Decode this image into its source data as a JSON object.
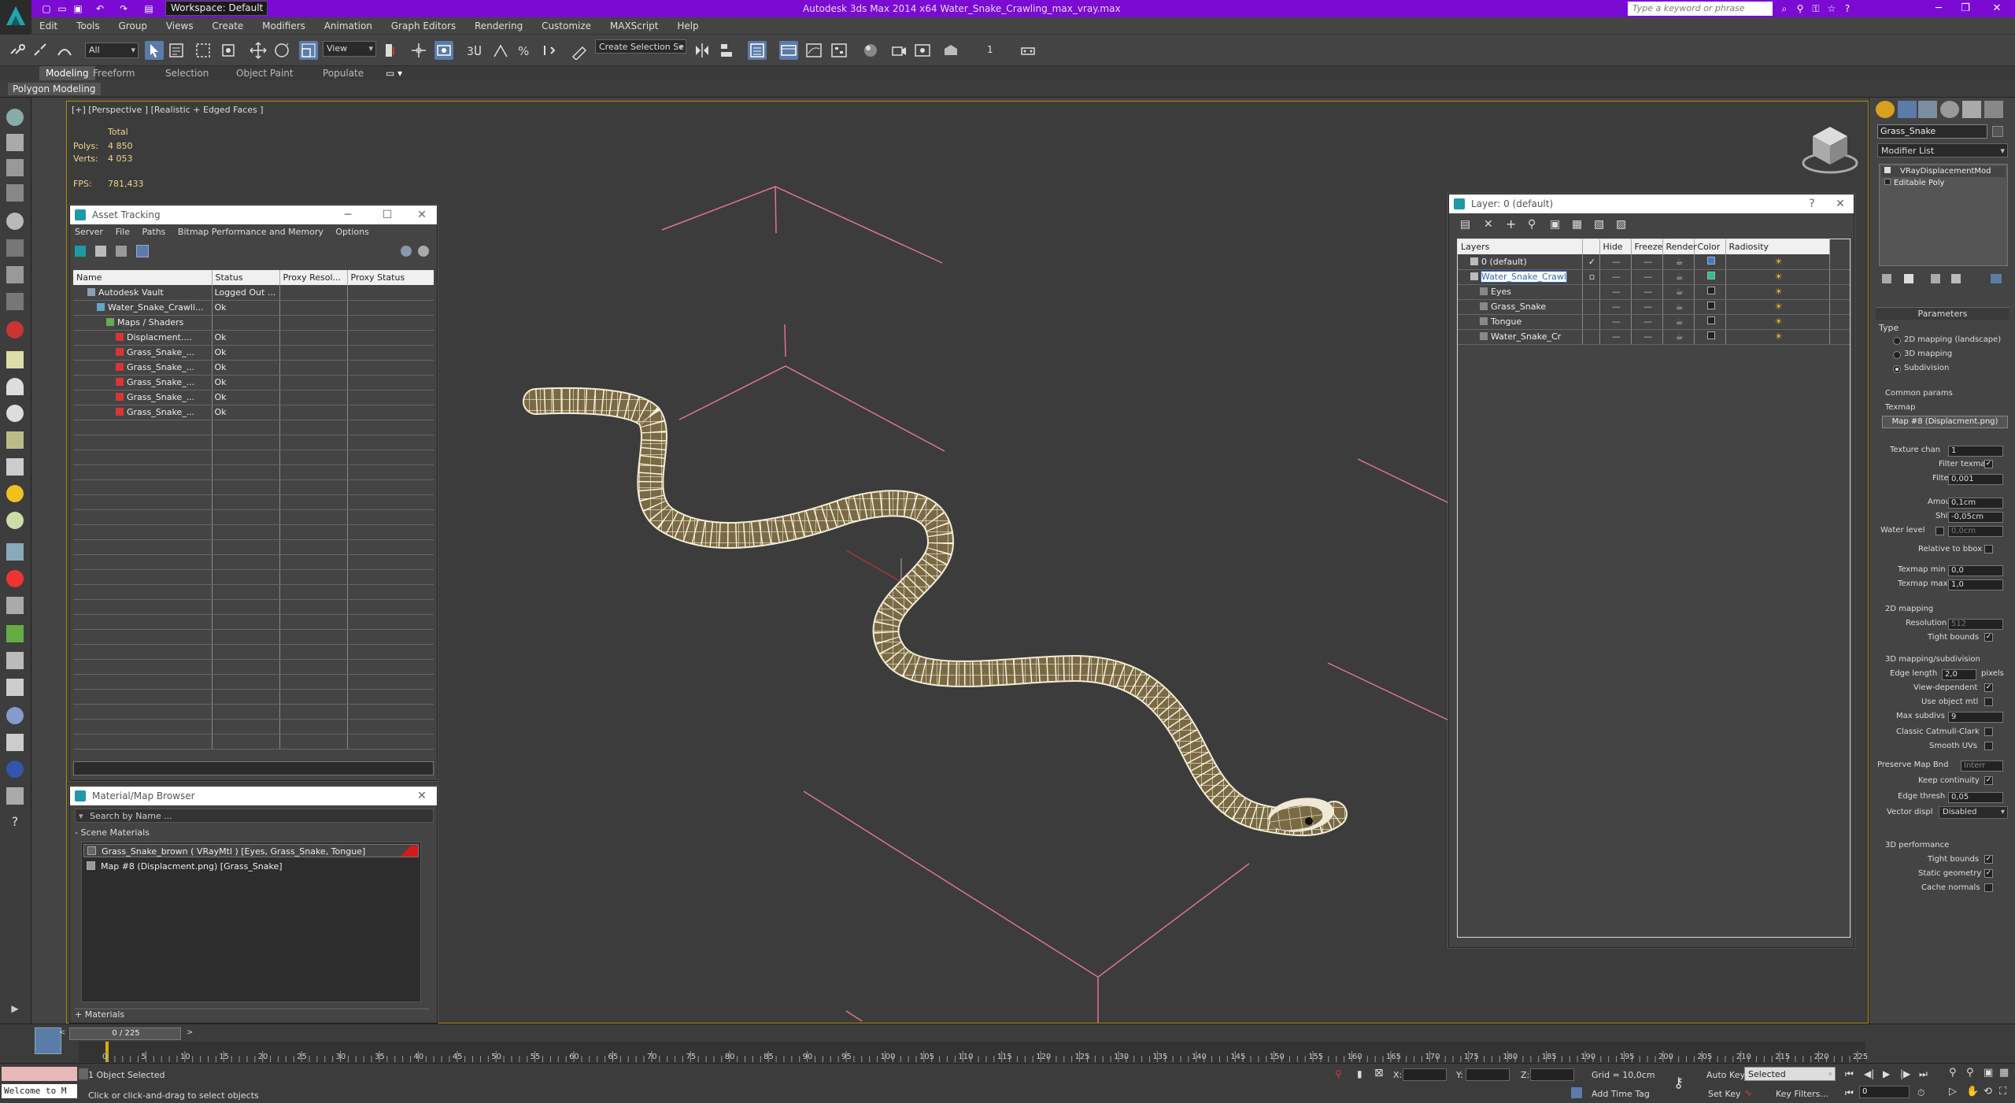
{
  "titlebar": {
    "title": "Autodesk 3ds Max  2014 x64     Water_Snake_Crawling_max_vray.max",
    "workspace": "Workspace: Default",
    "search_placeholder": "Type a keyword or phrase"
  },
  "menu": [
    "Edit",
    "Tools",
    "Group",
    "Views",
    "Create",
    "Modifiers",
    "Animation",
    "Graph Editors",
    "Rendering",
    "Customize",
    "MAXScript",
    "Help"
  ],
  "toolbar": {
    "selection_filter": "All",
    "ref_coord": "View",
    "named_selection": "Create Selection Se",
    "counter": "1"
  },
  "ribbon": {
    "tabs": [
      "Modeling",
      "Freeform",
      "Selection",
      "Object Paint",
      "Populate"
    ],
    "subtab": "Polygon Modeling"
  },
  "viewport": {
    "label": "[+] [Perspective ] [Realistic + Edged Faces ]",
    "stats": {
      "total_label": "Total",
      "polys_label": "Polys:",
      "polys_value": "4 850",
      "verts_label": "Verts:",
      "verts_value": "4 053",
      "fps_label": "FPS:",
      "fps_value": "781,433"
    }
  },
  "asset_tracking": {
    "title": "Asset Tracking",
    "menu": [
      "Server",
      "File",
      "Paths",
      "Bitmap Performance and Memory",
      "Options"
    ],
    "columns": [
      "Name",
      "Status",
      "Proxy Resol...",
      "Proxy Status"
    ],
    "rows": [
      {
        "name": "Autodesk Vault",
        "status": "Logged Out ...",
        "indent": 1
      },
      {
        "name": "Water_Snake_Crawli...",
        "status": "Ok",
        "indent": 2
      },
      {
        "name": "Maps / Shaders",
        "status": "",
        "indent": 3
      },
      {
        "name": "Displacment....",
        "status": "Ok",
        "indent": 4
      },
      {
        "name": "Grass_Snake_...",
        "status": "Ok",
        "indent": 4
      },
      {
        "name": "Grass_Snake_...",
        "status": "Ok",
        "indent": 4
      },
      {
        "name": "Grass_Snake_...",
        "status": "Ok",
        "indent": 4
      },
      {
        "name": "Grass_Snake_...",
        "status": "Ok",
        "indent": 4
      },
      {
        "name": "Grass_Snake_...",
        "status": "Ok",
        "indent": 4
      }
    ]
  },
  "material_browser": {
    "title": "Material/Map Browser",
    "search_placeholder": "Search by Name ...",
    "group": "- Scene Materials",
    "items": [
      "Grass_Snake_brown  ( VRayMtl ) [Eyes, Grass_Snake, Tongue]",
      "Map #8 (Displacment.png)  [Grass_Snake]"
    ],
    "footer_group": "+ Materials"
  },
  "layer_panel": {
    "title": "Layer: 0 (default)",
    "columns": [
      "Layers",
      "Hide",
      "Freeze",
      "Render",
      "Color",
      "Radiosity"
    ],
    "rows": [
      {
        "name": "0 (default)",
        "color": "#3e7bd8",
        "indent": 1
      },
      {
        "name": "Water_Snake_Crawl",
        "color": "#26c28a",
        "indent": 1,
        "selected": true
      },
      {
        "name": "Eyes",
        "color": "#222222",
        "indent": 2
      },
      {
        "name": "Grass_Snake",
        "color": "#222222",
        "indent": 2
      },
      {
        "name": "Tongue",
        "color": "#222222",
        "indent": 2
      },
      {
        "name": "Water_Snake_Cr",
        "color": "#222222",
        "indent": 2
      }
    ]
  },
  "command_panel": {
    "object_name": "Grass_Snake",
    "modifier_list": "Modifier List",
    "stack": [
      "VRayDisplacementMod",
      "Editable Poly"
    ],
    "parameters_title": "Parameters",
    "type_label": "Type",
    "type_options": [
      "2D mapping (landscape)",
      "3D mapping",
      "Subdivision"
    ],
    "common_title": "Common params",
    "texmap_label": "Texmap",
    "texmap_value": "Map #8 (Displacment.png)",
    "texture_chan_label": "Texture chan",
    "texture_chan_value": "1",
    "filter_texmap_label": "Filter texmap",
    "filter_blur_label": "Filter blur",
    "filter_blur_value": "0,001",
    "amount_label": "Amount",
    "amount_value": "0,1cm",
    "shift_label": "Shift",
    "shift_value": "-0,05cm",
    "water_level_label": "Water level",
    "water_level_value": "0,0cm",
    "relative_bbox_label": "Relative to bbox",
    "texmap_min_label": "Texmap min",
    "texmap_min_value": "0,0",
    "texmap_max_label": "Texmap max",
    "texmap_max_value": "1,0",
    "mapping2d_title": "2D mapping",
    "resolution_label": "Resolution",
    "resolution_value": "512",
    "tight_bounds_label": "Tight bounds",
    "subdiv_title": "3D mapping/subdivision",
    "edge_length_label": "Edge length",
    "edge_length_value": "2,0",
    "pixels_label": "pixels",
    "view_dependent_label": "View-dependent",
    "use_object_mtl_label": "Use object mtl",
    "max_subdivs_label": "Max subdivs",
    "max_subdivs_value": "9",
    "catmull_label": "Classic Catmull-Clark",
    "smooth_uvs_label": "Smooth UVs",
    "preserve_label": "Preserve Map Bnd",
    "preserve_value": "Interr",
    "keep_continuity_label": "Keep continuity",
    "edge_thresh_label": "Edge thresh",
    "edge_thresh_value": "0,05",
    "vector_disp_label": "Vector displ",
    "vector_disp_value": "Disabled",
    "perf_title": "3D performance",
    "perf_tight_label": "Tight bounds",
    "static_geom_label": "Static geometry",
    "cache_normals_label": "Cache normals"
  },
  "timeline": {
    "frame_counter": "0 / 225",
    "ticks": [
      "0",
      "5",
      "10",
      "15",
      "20",
      "25",
      "30",
      "35",
      "40",
      "45",
      "50",
      "55",
      "60",
      "65",
      "70",
      "75",
      "80",
      "85",
      "90",
      "95",
      "100",
      "105",
      "110",
      "115",
      "120",
      "125",
      "130",
      "135",
      "140",
      "145",
      "150",
      "155",
      "160",
      "165",
      "170",
      "175",
      "180",
      "185",
      "190",
      "195",
      "200",
      "205",
      "210",
      "215",
      "220",
      "225"
    ]
  },
  "status": {
    "maxscript": "Welcome to M",
    "selection": "1 Object Selected",
    "prompt": "Click or click-and-drag to select objects",
    "x_label": "X:",
    "y_label": "Y:",
    "z_label": "Z:",
    "grid": "Grid = 10,0cm",
    "add_time_tag": "Add Time Tag",
    "auto_key": "Auto Key",
    "auto_key_value": "Selected",
    "set_key": "Set Key",
    "key_filters": "Key Filters...",
    "frame_value": "0"
  }
}
